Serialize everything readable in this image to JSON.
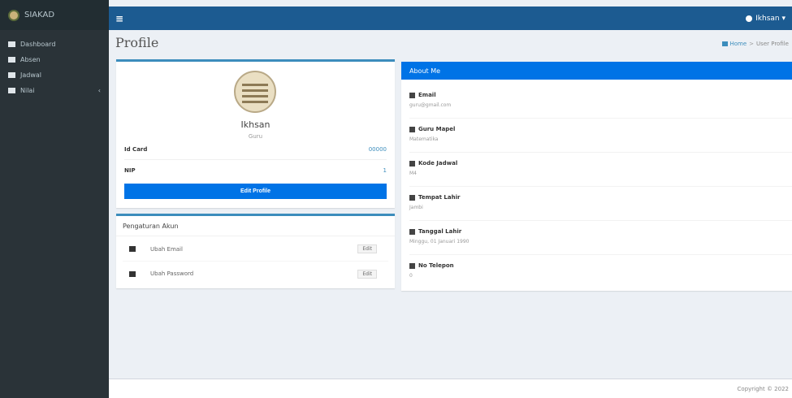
{
  "app": {
    "logo_text": "SIAKAD"
  },
  "header": {
    "menu_icon": "hamburger-icon",
    "user_name": "Ikhsan ▾",
    "user_icon": "user-icon"
  },
  "sidebar": {
    "items": [
      {
        "label": "Dashboard",
        "icon": "home-icon"
      },
      {
        "label": "Absen",
        "icon": "table-icon"
      },
      {
        "label": "Jadwal",
        "icon": "table-icon"
      },
      {
        "label": "Nilai",
        "icon": "video-icon",
        "has_caret": true
      }
    ]
  },
  "page": {
    "title": "Profile",
    "breadcrumb": {
      "home": "Home",
      "current": "User Profile"
    }
  },
  "profile": {
    "name": "Ikhsan",
    "role": "Guru",
    "id_card_label": "Id Card",
    "id_card_value": "00000",
    "nip_label": "NIP",
    "nip_value": "1",
    "edit_button": "Edit Profile"
  },
  "settings": {
    "title": "Pengaturan Akun",
    "rows": [
      {
        "label": "Ubah Email",
        "icon": "envelope-icon",
        "button": "Edit"
      },
      {
        "label": "Ubah Password",
        "icon": "key-icon",
        "button": "Edit"
      }
    ]
  },
  "about": {
    "title": "About Me",
    "items": [
      {
        "label": "Email",
        "value": "guru@gmail.com",
        "icon": "envelope-icon"
      },
      {
        "label": "Guru Mapel",
        "value": "Matematika",
        "icon": "book-icon"
      },
      {
        "label": "Kode Jadwal",
        "value": "M4",
        "icon": "file-icon"
      },
      {
        "label": "Tempat Lahir",
        "value": "Jambi",
        "icon": "map-marker-icon"
      },
      {
        "label": "Tanggal Lahir",
        "value": "Minggu, 01 Januari 1990",
        "icon": "calendar-icon"
      },
      {
        "label": "No Telepon",
        "value": "0",
        "icon": "phone-icon"
      }
    ]
  },
  "footer": {
    "text": "Copyright © 2022"
  },
  "colors": {
    "primary": "#0073e6",
    "navbar": "#1c5b91",
    "sidebar": "#2a3338",
    "accent": "#3c8dbc"
  }
}
